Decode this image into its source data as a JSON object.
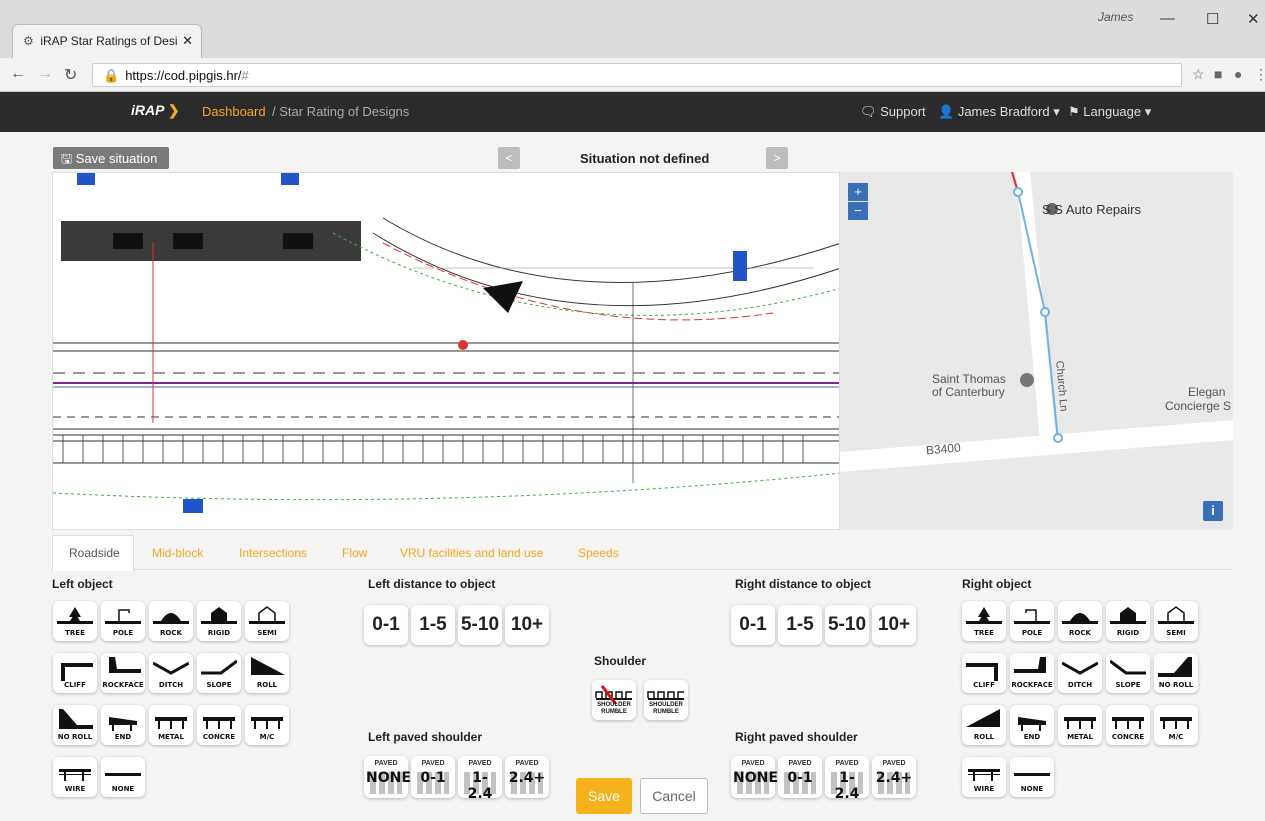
{
  "browser": {
    "tab_title": "iRAP Star Ratings of Desi",
    "user_chip": "James",
    "url_host": "https://cod.pipgis.hr/",
    "url_path": "#"
  },
  "app_nav": {
    "logo": "iRAP",
    "dashboard": "Dashboard",
    "breadcrumb": "/ Star Rating of Designs",
    "support": "Support",
    "user": "James Bradford",
    "language": "Language"
  },
  "toolbar": {
    "save_situation": "Save situation",
    "situation_title": "Situation not defined",
    "prev": "<",
    "next": ">"
  },
  "map": {
    "poi1": "S S Auto Repairs",
    "poi2_line1": "Saint Thomas",
    "poi2_line2": "of Canterbury",
    "street_church": "Church Ln",
    "road": "B3400",
    "poi3_line1": "Elegan",
    "poi3_line2": "Concierge S",
    "zoom_in": "+",
    "zoom_out": "−",
    "info": "i"
  },
  "tabs": [
    "Roadside",
    "Mid-block",
    "Intersections",
    "Flow",
    "VRU facilities and land use",
    "Speeds"
  ],
  "sections": {
    "left_object": "Left object",
    "left_distance": "Left distance to object",
    "right_distance": "Right distance to object",
    "right_object": "Right object",
    "shoulder": "Shoulder",
    "left_paved": "Left paved shoulder",
    "right_paved": "Right paved shoulder"
  },
  "left_objects": [
    "TREE",
    "POLE",
    "ROCK",
    "RIGID",
    "SEMI",
    "CLIFF",
    "ROCKFACE",
    "DITCH",
    "SLOPE",
    "ROLL",
    "NO ROLL",
    "END",
    "METAL",
    "CONCRE",
    "M/C",
    "WIRE",
    "NONE"
  ],
  "right_objects": [
    "TREE",
    "POLE",
    "ROCK",
    "RIGID",
    "SEMI",
    "CLIFF",
    "ROCKFACE",
    "DITCH",
    "SLOPE",
    "NO ROLL",
    "ROLL",
    "END",
    "METAL",
    "CONCRE",
    "M/C",
    "WIRE",
    "NONE"
  ],
  "distances": [
    "0-1",
    "1-5",
    "5-10",
    "10+"
  ],
  "shoulder_options": [
    {
      "l1": "SHOULDER",
      "l2": "RUMBLE",
      "crossed": true
    },
    {
      "l1": "SHOULDER",
      "l2": "RUMBLE",
      "crossed": false
    }
  ],
  "paved": {
    "prefix": "PAVED",
    "values": [
      "NONE",
      "0-1",
      "1-2.4",
      "2.4+"
    ]
  },
  "actions": {
    "save": "Save",
    "cancel": "Cancel"
  },
  "colors": {
    "accent": "#f5a623",
    "nav_bg": "#2b2b2b",
    "map_route": "#6fb3e0",
    "map_blue": "#3b6fb5"
  }
}
